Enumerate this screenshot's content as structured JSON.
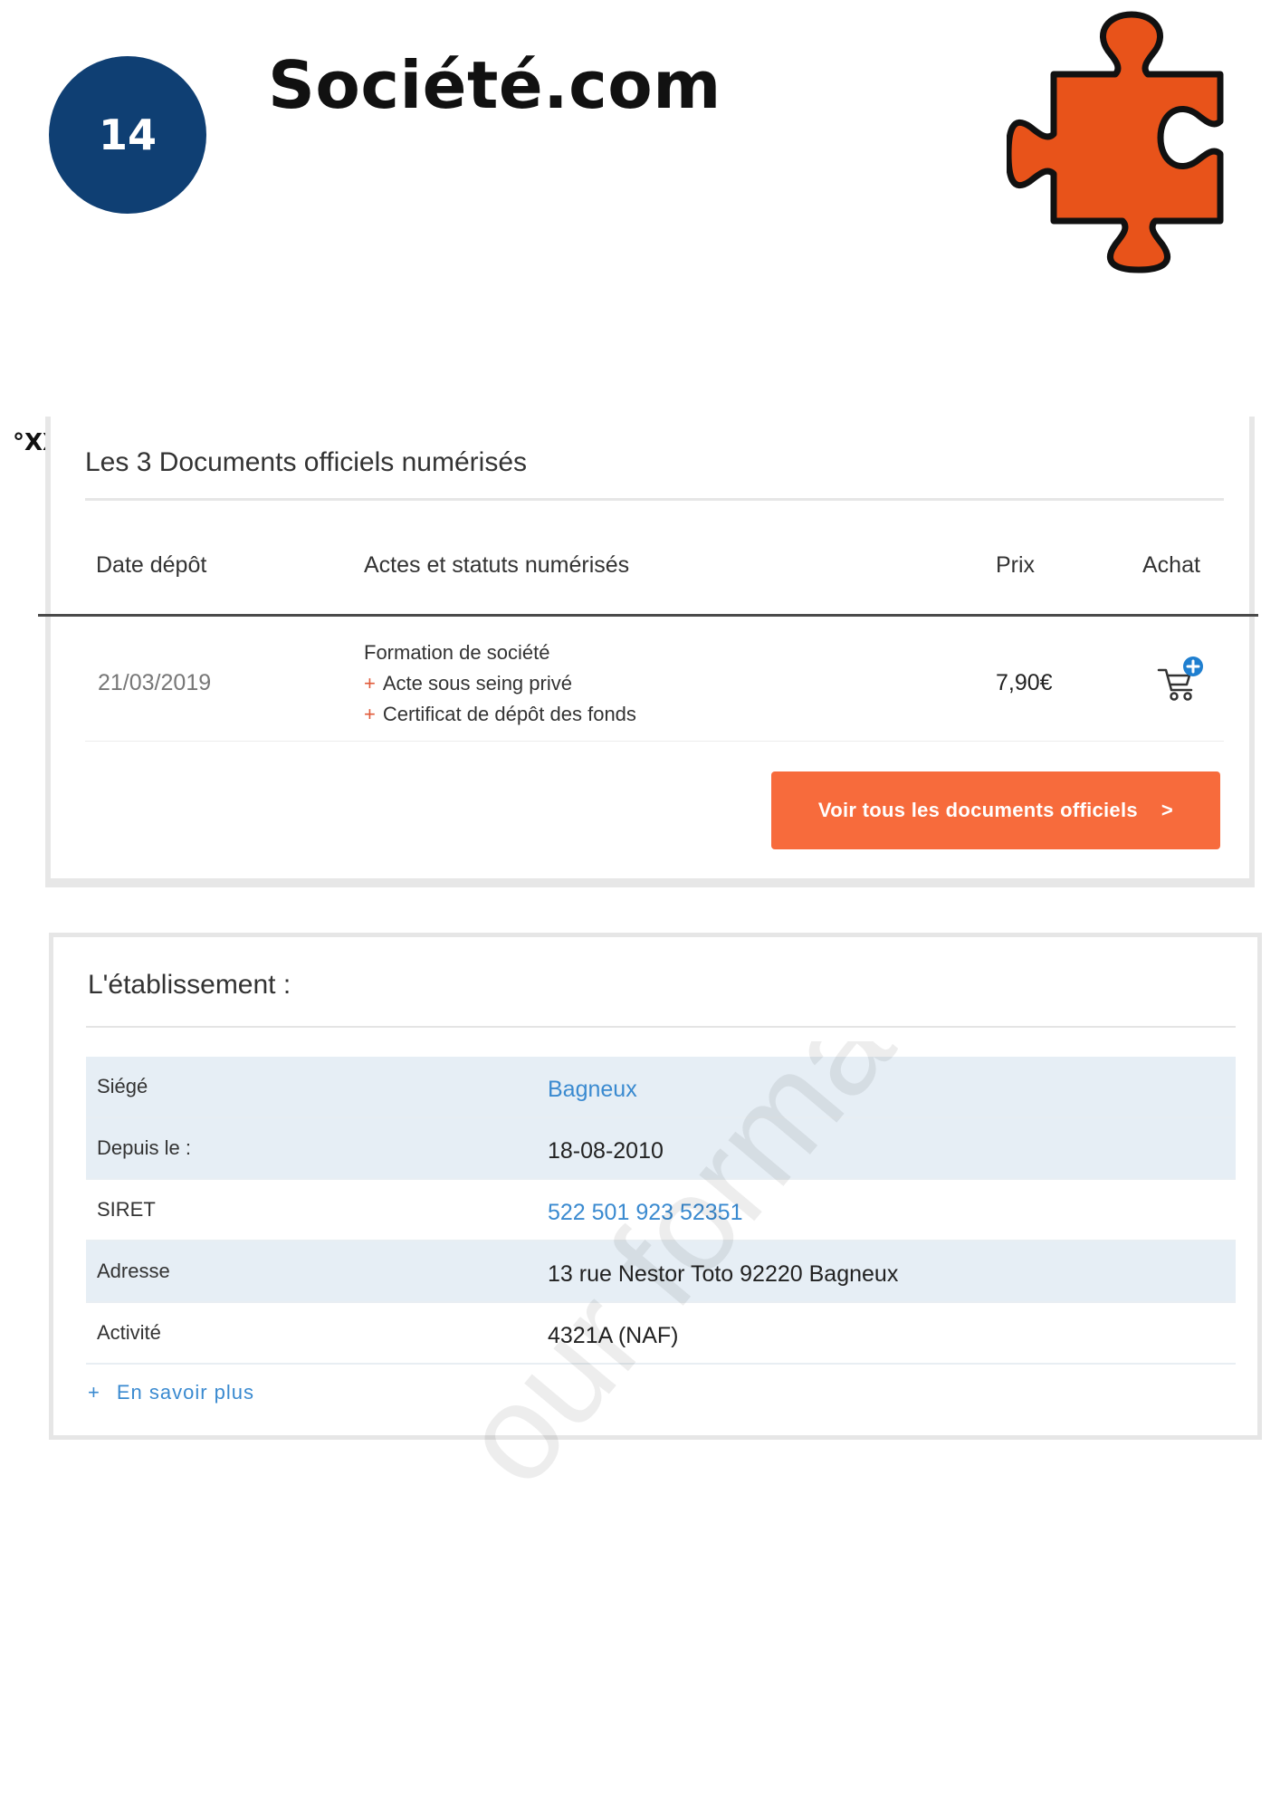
{
  "header": {
    "badge_number": "14",
    "brand": "Société.com",
    "corner_mark": "°XX",
    "puzzle_color": "#e8531a"
  },
  "documents": {
    "title": "Les 3 Documents officiels numérisés",
    "columns": [
      "Date dépôt",
      "Actes et statuts numérisés",
      "Prix",
      "Achat"
    ],
    "row": {
      "date": "21/03/2019",
      "acte_main": "Formation de société",
      "acte_items": [
        "Acte sous seing privé",
        "Certificat de dépôt des fonds"
      ],
      "prix": "7,90€",
      "achat_icon": "cart-plus-icon"
    },
    "button_label": "Voir tous les documents officiels",
    "button_chevron": ">",
    "accent_color": "#f76b3c"
  },
  "etablissement": {
    "title": "L'établissement :",
    "rows": [
      {
        "label": "Siégé",
        "value": "Bagneux"
      },
      {
        "label": "Depuis le :",
        "value": "18-08-2010"
      },
      {
        "label": "SIRET",
        "value": "522 501 923 52351"
      },
      {
        "label": "Adresse",
        "value": "13 rue Nestor Toto 92220 Bagneux"
      },
      {
        "label": "Activité",
        "value": "4321A (NAF)"
      }
    ],
    "more_plus": "+",
    "more_label": "En savoir plus",
    "link_color": "#3a8ad0"
  },
  "watermark_text": "our formation"
}
